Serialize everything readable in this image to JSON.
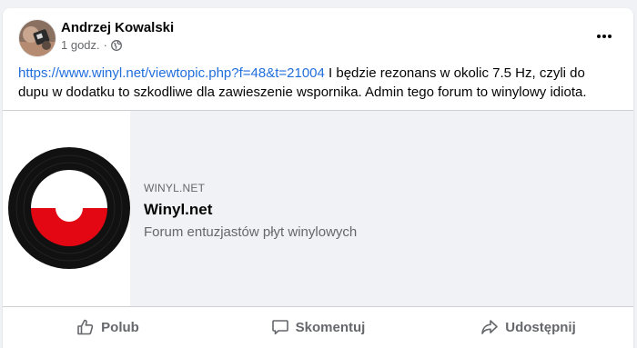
{
  "post": {
    "author": "Andrzej Kowalski",
    "time": "1 godz.",
    "meta_separator": "·",
    "visibility_icon": "globe-icon",
    "more_icon": "more-horizontal-icon",
    "link_url": "https://www.winyl.net/viewtopic.php?f=48&t=21004",
    "text_after_link": " I będzie rezonans w okolic 7.5 Hz, czyli do dupu w dodatku to szkodliwe dla zawieszenie wspornika. Admin tego forum to winylowy idiota."
  },
  "link_preview": {
    "domain": "WINYL.NET",
    "title": "Winyl.net",
    "description": "Forum entuzjastów płyt winylowych",
    "image": "vinyl-record-logo"
  },
  "actions": {
    "like_label": "Polub",
    "comment_label": "Skomentuj",
    "share_label": "Udostępnij"
  },
  "colors": {
    "link": "#216fdb",
    "secondary_text": "#65676b",
    "record_black": "#111111",
    "record_red": "#e30613"
  }
}
